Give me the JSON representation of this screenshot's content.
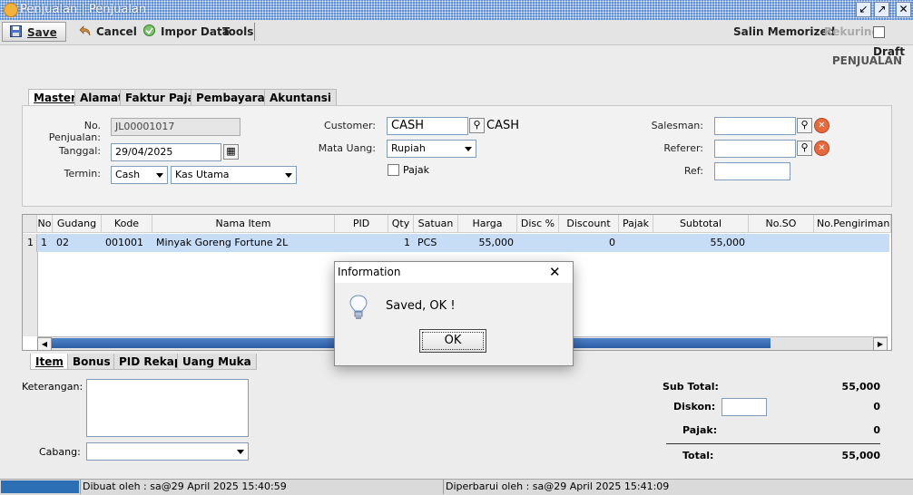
{
  "window": {
    "title": "Penjualan | Penjualan"
  },
  "toolbar": {
    "save": "Save",
    "cancel": "Cancel",
    "import": "Impor Data",
    "tools": "Tools",
    "salin": "Salin Memorized",
    "rekuring": "Rekuring",
    "draft": "Draft"
  },
  "heading": "PENJUALAN",
  "tabs": [
    "Master",
    "Alamat",
    "Faktur Pajak",
    "Pembayaran",
    "Akuntansi"
  ],
  "form": {
    "no_label": "No. Penjualan:",
    "no_value": "JL00001017",
    "tanggal_label": "Tanggal:",
    "tanggal_value": "29/04/2025",
    "termin_label": "Termin:",
    "termin_value": "Cash",
    "kas_value": "Kas Utama",
    "customer_label": "Customer:",
    "customer_value": "CASH",
    "customer_name": "CASH",
    "mata_uang_label": "Mata Uang:",
    "mata_uang_value": "Rupiah",
    "pajak_label": "Pajak",
    "salesman_label": "Salesman:",
    "referer_label": "Referer:",
    "ref_label": "Ref:"
  },
  "grid": {
    "headers": [
      "No",
      "Gudang",
      "Kode Item",
      "Nama Item",
      "PID",
      "Qty",
      "Satuan",
      "Harga",
      "Disc %",
      "Discount",
      "Pajak",
      "Subtotal",
      "No.SO",
      "No.Pengiriman"
    ],
    "row": {
      "rownum": "1",
      "no": "1",
      "gudang": "02",
      "kode": "001001",
      "nama": "Minyak Goreng Fortune 2L",
      "pid": "",
      "qty": "1",
      "satuan": "PCS",
      "harga": "55,000",
      "disc_pct": "",
      "discount": "0",
      "pajak": "",
      "subtotal": "55,000",
      "no_so": "",
      "no_pengiriman": ""
    }
  },
  "bottom_tabs": [
    "Item",
    "Bonus",
    "PID Rekap",
    "Uang Muka"
  ],
  "notes": {
    "keterangan_label": "Keterangan:",
    "cabang_label": "Cabang:"
  },
  "summary": {
    "sub_total_label": "Sub Total:",
    "sub_total": "55,000",
    "diskon_label": "Diskon:",
    "diskon": "0",
    "pajak_label": "Pajak:",
    "pajak": "0",
    "total_label": "Total:",
    "total": "55,000"
  },
  "dialog": {
    "title": "Information",
    "message": "Saved, OK !",
    "ok": "OK"
  },
  "status": {
    "created": "Dibuat oleh : sa@29 April 2025  15:40:59",
    "updated": "Diperbarui oleh : sa@29 April 2025  15:41:09"
  }
}
